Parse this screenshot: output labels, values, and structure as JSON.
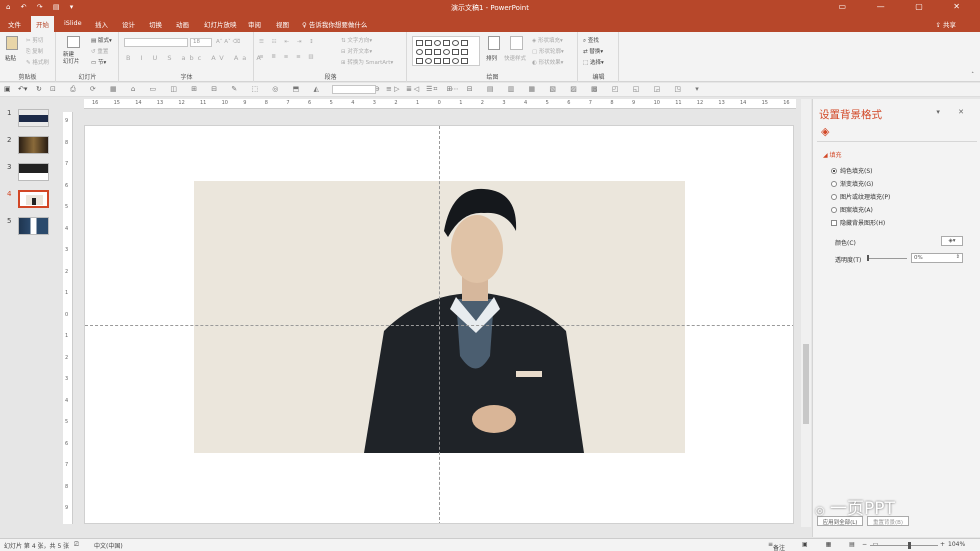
{
  "window": {
    "title": "演示文稿1 - PowerPoint",
    "qat": "⌂ ↶ ↷ ▤ ▾"
  },
  "tabs": [
    "文件",
    "开始",
    "iSlide",
    "插入",
    "设计",
    "切换",
    "动画",
    "幻灯片放映",
    "审阅",
    "视图"
  ],
  "tell_me": "告诉我你想要做什么",
  "share": "共享",
  "ribbon": {
    "clipboard": {
      "label": "剪贴板",
      "paste": "粘贴",
      "cut": "剪切",
      "copy": "复制",
      "painter": "格式刷"
    },
    "slides": {
      "label": "幻灯片",
      "new_slide": "新建\n幻灯片",
      "layout": "版式",
      "reset": "重置",
      "section": "节"
    },
    "font": {
      "label": "字体",
      "size": "18"
    },
    "paragraph": {
      "label": "段落",
      "text_direction": "文字方向",
      "align_text": "对齐文本",
      "smartart": "转换为 SmartArt"
    },
    "drawing": {
      "label": "绘图",
      "arrange": "排列",
      "quick_styles": "快速样式",
      "fill": "形状填充",
      "outline": "形状轮廓",
      "effects": "形状效果"
    },
    "editing": {
      "label": "编辑",
      "find": "查找",
      "replace": "替换",
      "select": "选择"
    }
  },
  "slides": [
    {
      "num": "1"
    },
    {
      "num": "2"
    },
    {
      "num": "3"
    },
    {
      "num": "4"
    },
    {
      "num": "5"
    }
  ],
  "pane": {
    "title": "设置背景格式",
    "section": "填充",
    "options": [
      "纯色填充(S)",
      "渐变填充(G)",
      "图片或纹理填充(P)",
      "图案填充(A)"
    ],
    "selected": 0,
    "hide_bg": "隐藏背景图形(H)",
    "color_label": "颜色(C)",
    "transparency_label": "透明度(T)",
    "transparency_value": "0%",
    "apply_all": "应用到全部(L)",
    "reset_bg": "重置背景(B)"
  },
  "status": {
    "slide_info": "幻灯片 第 4 张，共 5 张",
    "lang": "中文(中国)",
    "notes": "备注",
    "zoom": "104%"
  },
  "watermark": "一页PPT"
}
